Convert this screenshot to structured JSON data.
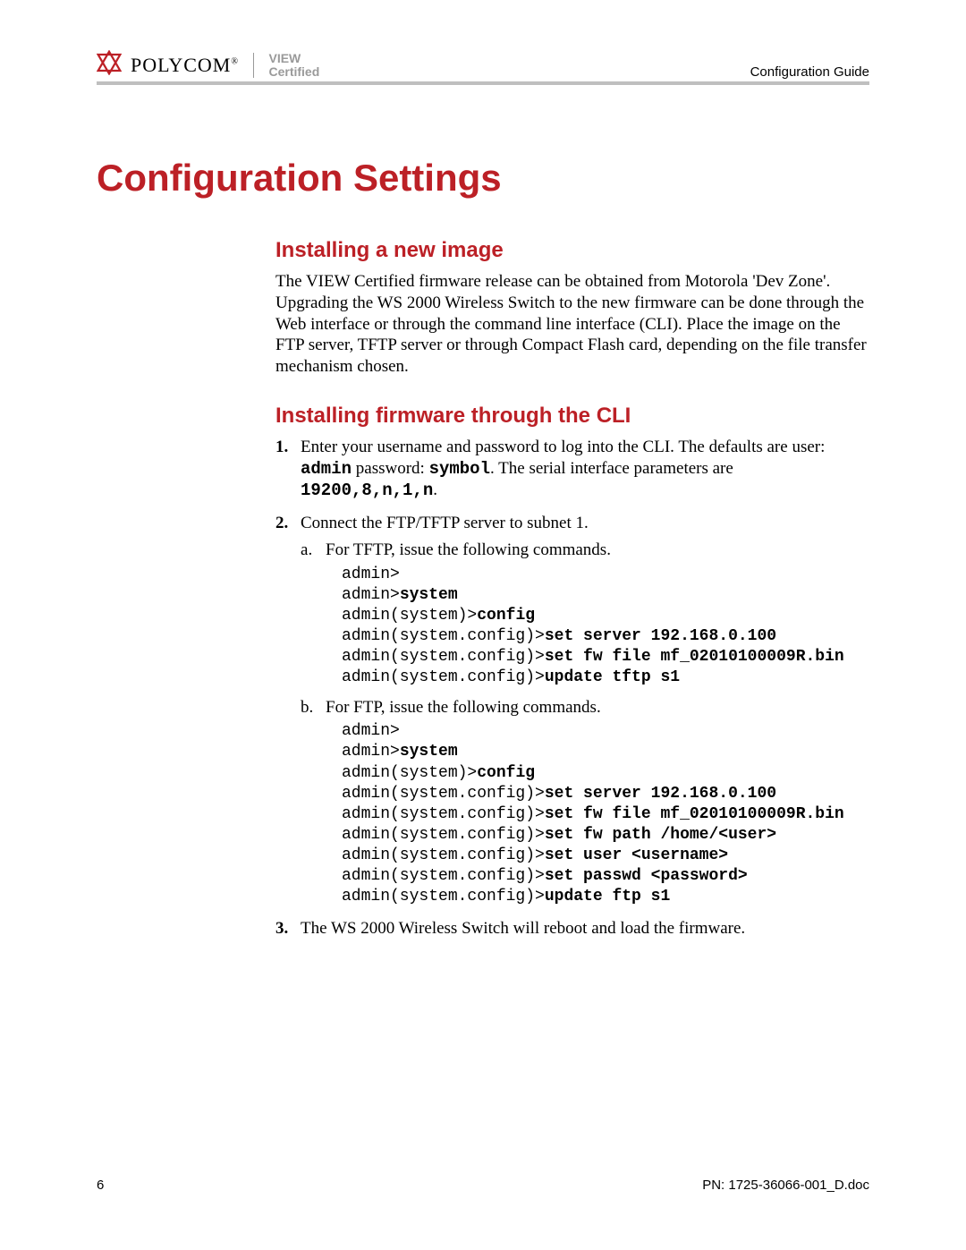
{
  "header": {
    "brand": "POLYCOM",
    "trademark": "®",
    "tag_line1": "VIEW",
    "tag_line2": "Certified",
    "guide": "Configuration Guide"
  },
  "title": "Configuration Settings",
  "section1": {
    "heading": "Installing a new image",
    "paragraph": "The VIEW Certified firmware release can be obtained from Motorola 'Dev Zone'. Upgrading the WS 2000 Wireless Switch to the new firmware can be done through the Web interface or through the command line interface (CLI). Place the image on the FTP server, TFTP server or through Compact Flash card, depending on the file transfer mechanism chosen."
  },
  "section2": {
    "heading": "Installing firmware through the CLI",
    "step1_pre": "Enter your username and password to log into the CLI.  The defaults are user: ",
    "step1_user": "admin",
    "step1_mid": " password: ",
    "step1_pass": "symbol",
    "step1_post1": ".  The serial interface parameters are ",
    "step1_params": "19200,8,n,1,n",
    "step1_post2": ".",
    "step2": "Connect the FTP/TFTP server to subnet 1.",
    "step2a": "For TFTP, issue the following commands.",
    "cmd_a": [
      {
        "prompt": "admin>",
        "cmd": ""
      },
      {
        "prompt": "admin>",
        "cmd": "system"
      },
      {
        "prompt": "admin(system)>",
        "cmd": "config"
      },
      {
        "prompt": "admin(system.config)>",
        "cmd": "set server 192.168.0.100"
      },
      {
        "prompt": "admin(system.config)>",
        "cmd": "set fw file mf_02010100009R.bin"
      },
      {
        "prompt": "admin(system.config)>",
        "cmd": "update tftp s1"
      }
    ],
    "step2b": "For FTP, issue the following commands.",
    "cmd_b": [
      {
        "prompt": "admin>",
        "cmd": ""
      },
      {
        "prompt": "admin>",
        "cmd": "system"
      },
      {
        "prompt": "admin(system)>",
        "cmd": "config"
      },
      {
        "prompt": "admin(system.config)>",
        "cmd": "set server 192.168.0.100"
      },
      {
        "prompt": "admin(system.config)>",
        "cmd": "set fw file mf_02010100009R.bin"
      },
      {
        "prompt": "admin(system.config)>",
        "cmd": "set fw path /home/<user>"
      },
      {
        "prompt": "admin(system.config)>",
        "cmd": "set user <username>"
      },
      {
        "prompt": "admin(system.config)>",
        "cmd": "set passwd <password>"
      },
      {
        "prompt": "admin(system.config)>",
        "cmd": "update ftp s1"
      }
    ],
    "step3": "The WS 2000 Wireless Switch will reboot and load the firmware."
  },
  "footer": {
    "page": "6",
    "pn": "PN: 1725-36066-001_D.doc"
  }
}
